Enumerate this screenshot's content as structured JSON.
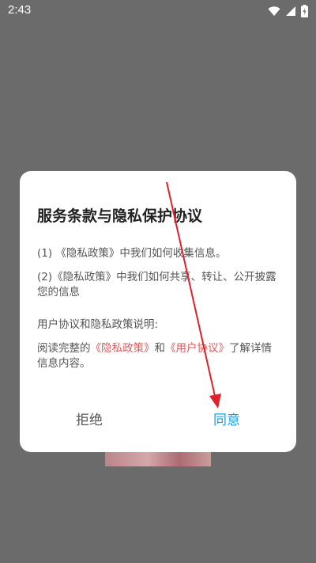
{
  "status_bar": {
    "time": "2:43",
    "icons": [
      "wifi-icon",
      "signal-icon",
      "battery-charging-icon"
    ]
  },
  "dialog": {
    "title": "服务条款与隐私保护协议",
    "item1": "(1) 《隐私政策》中我们如何收集信息。",
    "item2": "(2)《隐私政策》中我们如何共享、转让、公开披露您的信息",
    "explain_heading": "用户协议和隐私政策说明:",
    "explain_prefix": "阅读完整的",
    "privacy_link": "《隐私政策》",
    "explain_and": "和",
    "user_link": "《用户协议》",
    "explain_suffix": "了解详情信息内容。",
    "reject_label": "拒绝",
    "agree_label": "同意"
  },
  "colors": {
    "overlay": "#6b6b6b",
    "link": "#e25757",
    "agree": "#1a9fe0",
    "annotation_arrow": "#e0202a"
  }
}
